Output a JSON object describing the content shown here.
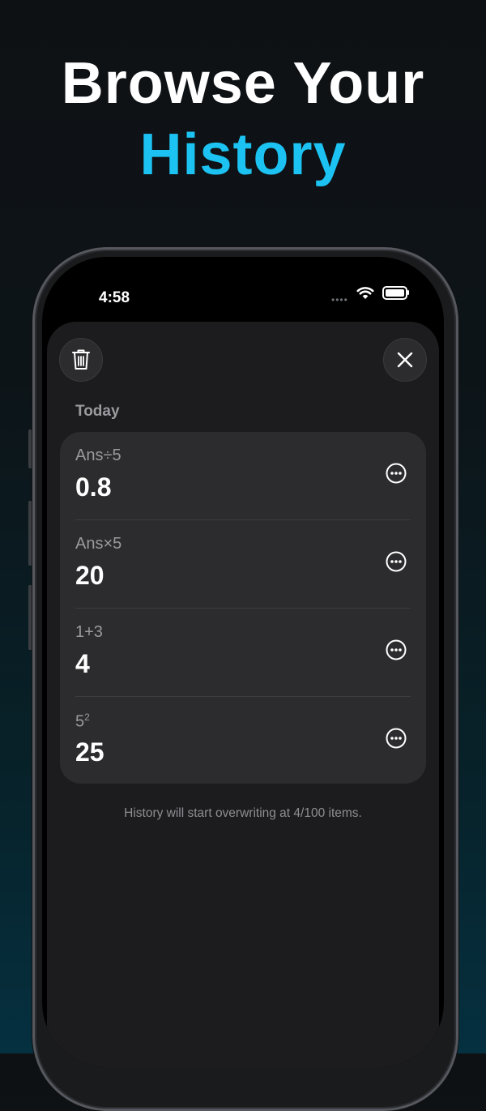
{
  "headline": {
    "line1": "Browse Your",
    "line2": "History"
  },
  "status_bar": {
    "time": "4:58",
    "signal_dots": "••••"
  },
  "toolbar": {
    "trash_icon": "trash-icon",
    "close_icon": "close-icon"
  },
  "history": {
    "section_label": "Today",
    "items": [
      {
        "expression": "Ans÷5",
        "result": "0.8"
      },
      {
        "expression": "Ans×5",
        "result": "20"
      },
      {
        "expression": "1+3",
        "result": "4"
      },
      {
        "expression_base": "5",
        "expression_sup": "2",
        "result": "25"
      }
    ],
    "footer": "History will start overwriting at 4/100 items."
  },
  "colors": {
    "accent": "#1cc3f2",
    "sheet": "#1c1c1e",
    "card": "#2c2c2e"
  }
}
